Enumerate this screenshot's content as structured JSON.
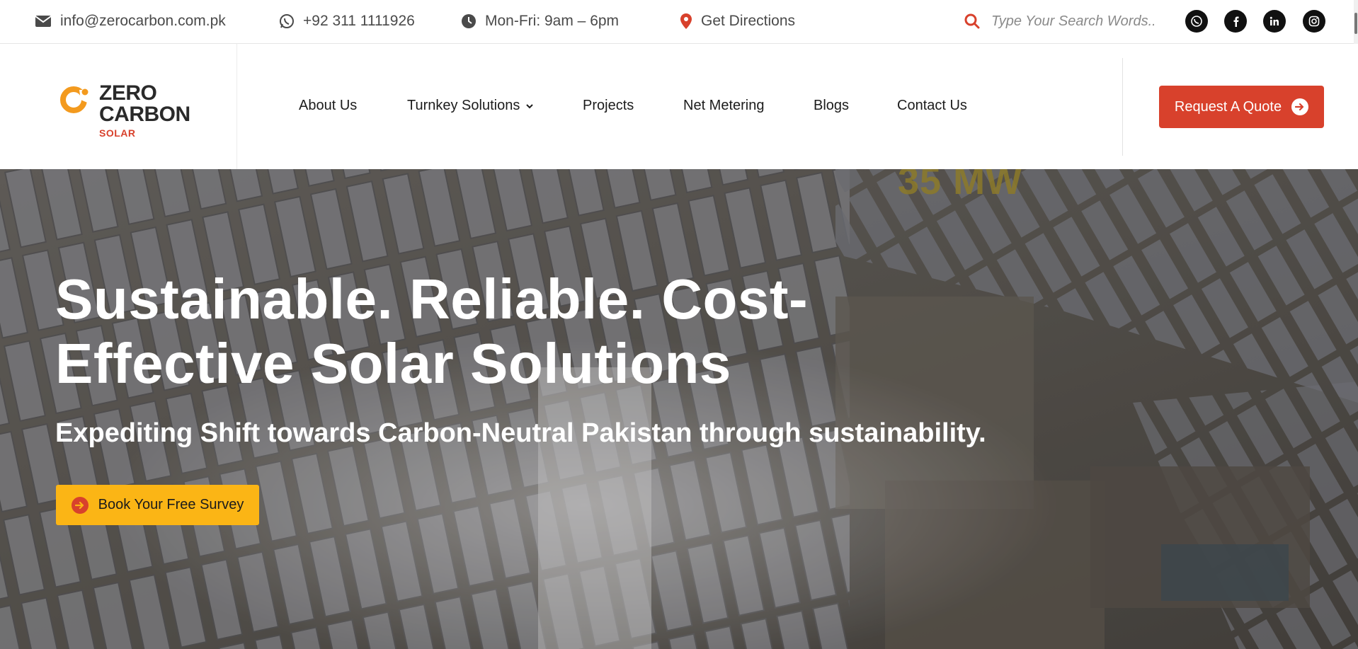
{
  "topbar": {
    "email": "info@zerocarbon.com.pk",
    "phone": "+92 311 1111926",
    "hours": "Mon-Fri: 9am – 6pm",
    "directions": "Get Directions",
    "search_placeholder": "Type Your Search Words...",
    "social_icons": [
      "whatsapp-icon",
      "facebook-icon",
      "linkedin-icon",
      "instagram-icon"
    ]
  },
  "logo": {
    "line1": "ZERO",
    "line2": "CARBON",
    "line3": "SOLAR"
  },
  "nav": {
    "items": [
      {
        "label": "About Us"
      },
      {
        "label": "Turnkey Solutions",
        "has_dropdown": true
      },
      {
        "label": "Projects"
      },
      {
        "label": "Net Metering"
      },
      {
        "label": "Blogs"
      },
      {
        "label": "Contact Us"
      }
    ],
    "cta_label": "Request A Quote"
  },
  "hero": {
    "overlay_text": "35 MW",
    "title": "Sustainable. Reliable. Cost-Effective Solar Solutions",
    "subtitle": "Expediting Shift towards Carbon-Neutral Pakistan through sustainability.",
    "cta_label": "Book Your Free Survey"
  },
  "colors": {
    "brand_red": "#d8412c",
    "brand_yellow": "#fbb515",
    "logo_orange": "#f39a1e"
  }
}
